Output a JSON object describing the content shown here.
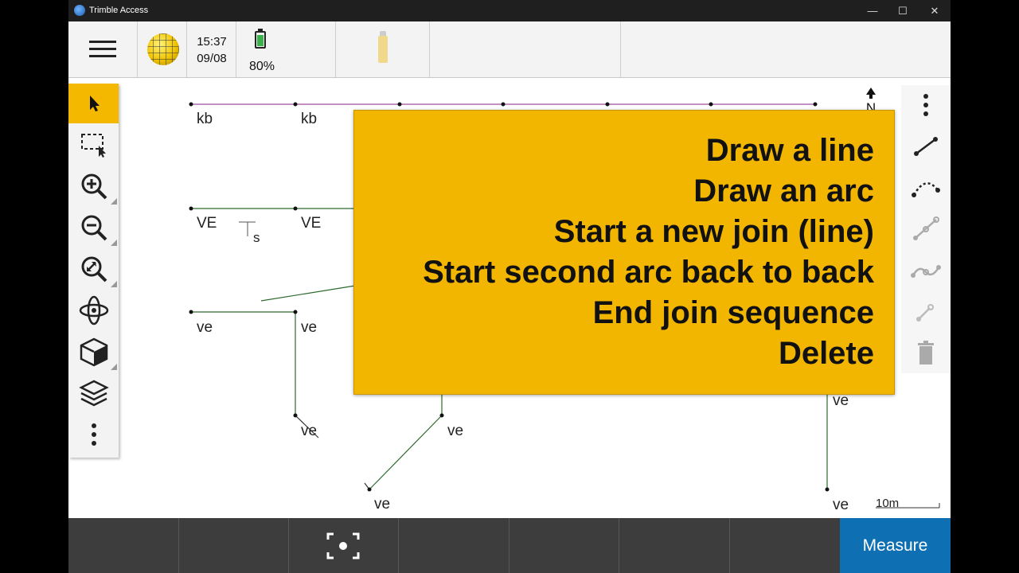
{
  "window": {
    "title": "Trimble Access",
    "minimize": "—",
    "maximize": "☐",
    "close": "✕"
  },
  "status": {
    "time": "15:37",
    "date": "09/08",
    "battery": "80%"
  },
  "map_labels": {
    "kb1": "kb",
    "kb2": "kb",
    "VE1": "VE",
    "VE2": "VE",
    "s": "s",
    "ve1": "ve",
    "ve2": "ve",
    "ve3": "ve",
    "ve4": "ve",
    "ve5": "ve",
    "ve6": "ve",
    "ve7": "ve"
  },
  "north": "N",
  "scale": "10m",
  "popup": {
    "lines": [
      "Draw a line",
      "Draw an arc",
      "Start a new join (line)",
      "Start second arc back to back",
      "End join sequence",
      "Delete"
    ]
  },
  "measure_label": "Measure",
  "colors": {
    "accent": "#f5b800",
    "popup": "#f2b600",
    "measure": "#0f6fb3",
    "bottom": "#3d3d3d"
  },
  "icons": {
    "left_toolbar": [
      "select-arrow-icon",
      "box-select-icon",
      "zoom-in-icon",
      "zoom-out-icon",
      "zoom-extents-icon",
      "orbit-icon",
      "cube-view-icon",
      "layers-icon",
      "more-vertical-icon"
    ],
    "right_toolbar": [
      "more-vertical-icon",
      "draw-line-icon",
      "draw-arc-icon",
      "join-line-icon",
      "join-arc-icon",
      "end-join-icon",
      "delete-icon"
    ]
  }
}
